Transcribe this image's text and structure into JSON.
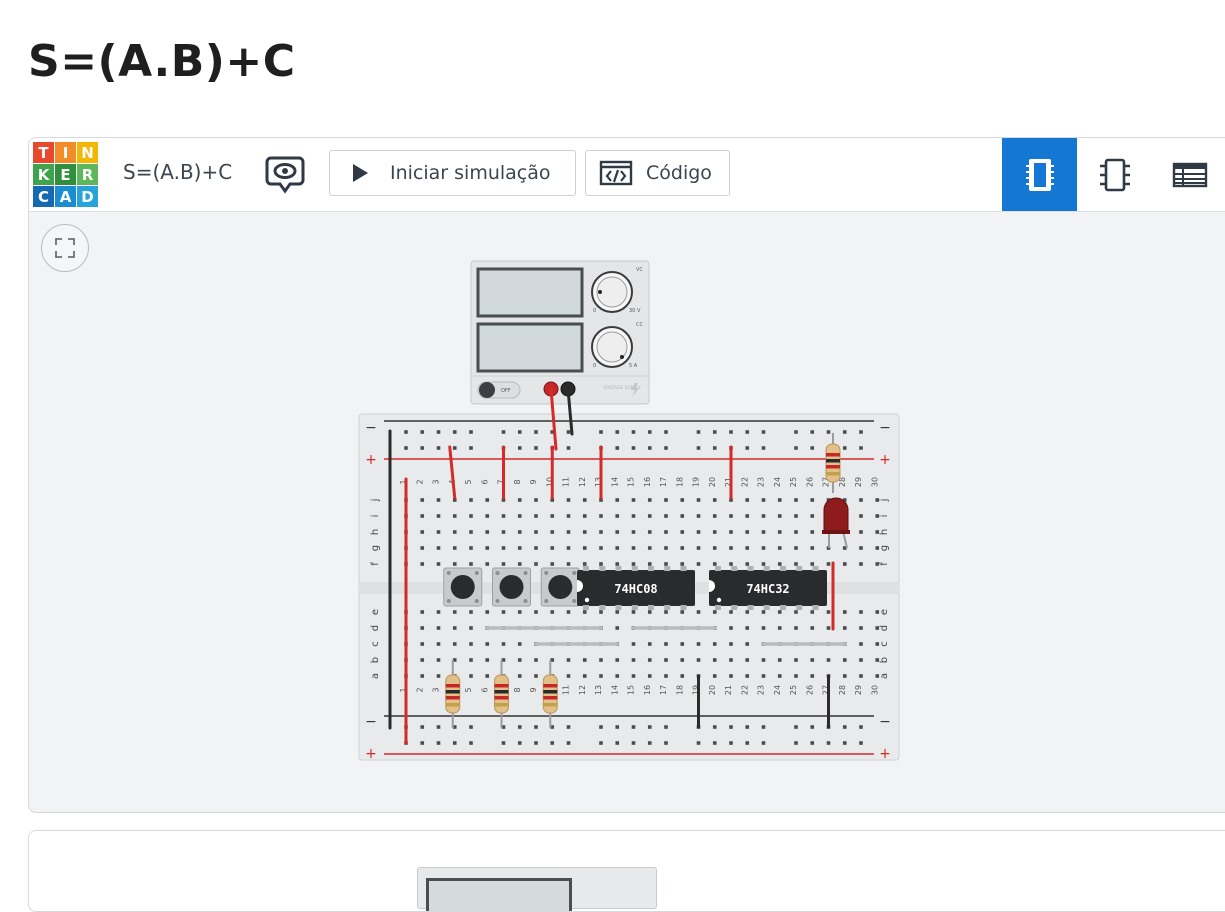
{
  "page": {
    "title": "S=(A.B)+C"
  },
  "toolbar": {
    "logo_rows": [
      [
        "T",
        "I",
        "N"
      ],
      [
        "K",
        "E",
        "R"
      ],
      [
        "C",
        "A",
        "D"
      ]
    ],
    "project_name": "S=(A.B)+C",
    "start_sim_label": "Iniciar simulação",
    "code_label": "Código",
    "active_view": "circuit-view"
  },
  "circuit": {
    "chips": [
      "74HC08",
      "74HC32"
    ],
    "column_numbers": [
      "1",
      "2",
      "3",
      "4",
      "5",
      "6",
      "7",
      "8",
      "9",
      "10",
      "11",
      "12",
      "13",
      "14",
      "15",
      "16",
      "17",
      "18",
      "19",
      "20",
      "21",
      "22",
      "23",
      "24",
      "25",
      "26",
      "27",
      "28",
      "29",
      "30"
    ],
    "row_letters_top": [
      "j",
      "i",
      "h",
      "g",
      "f"
    ],
    "row_letters_bottom": [
      "e",
      "d",
      "c",
      "b",
      "a"
    ],
    "rail_minus": "−",
    "rail_plus": "+",
    "power_supply": {
      "switch_label": "OFF",
      "knob1_min": "0",
      "knob1_max": "30 V",
      "knob1_mode": "VC",
      "knob2_min": "0",
      "knob2_max": "5 A",
      "knob2_mode": "CC",
      "brand": "VOLTAGE SUPPLY"
    }
  },
  "colors": {
    "accent": "#1477d4",
    "rail_red": "#d42a2a",
    "rail_black": "#333333",
    "wire_red": "#d42a2a",
    "wire_black": "#2b2b2b",
    "chip": "#2a2b2d",
    "led": "#8e1c1c",
    "board": "#e9eaeb"
  }
}
